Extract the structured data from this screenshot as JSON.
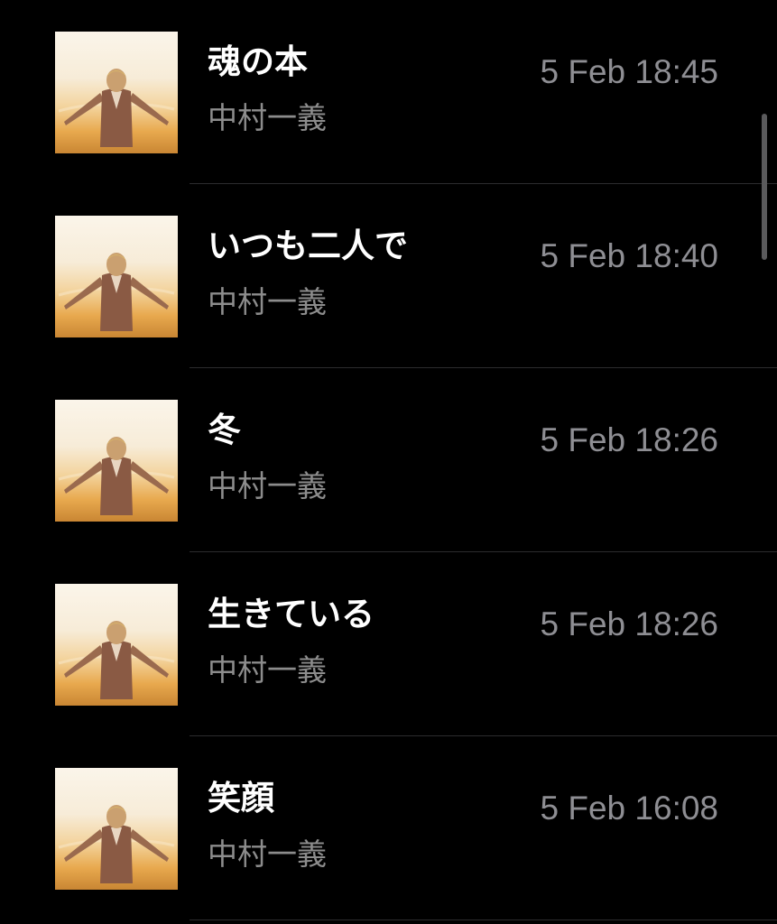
{
  "songs": [
    {
      "title": "魂の本",
      "artist": "中村一義",
      "timestamp": "5 Feb 18:45"
    },
    {
      "title": "いつも二人で",
      "artist": "中村一義",
      "timestamp": "5 Feb 18:40"
    },
    {
      "title": "冬",
      "artist": "中村一義",
      "timestamp": "5 Feb 18:26"
    },
    {
      "title": "生きている",
      "artist": "中村一義",
      "timestamp": "5 Feb 18:26"
    },
    {
      "title": "笑顔",
      "artist": "中村一義",
      "timestamp": "5 Feb 16:08"
    }
  ],
  "colors": {
    "background": "#000000",
    "title": "#ffffff",
    "subtitle": "#8c8c8c",
    "separator": "#2c2c2e"
  },
  "icons": {
    "album_art": "album-art-person-arms-outstretched"
  }
}
